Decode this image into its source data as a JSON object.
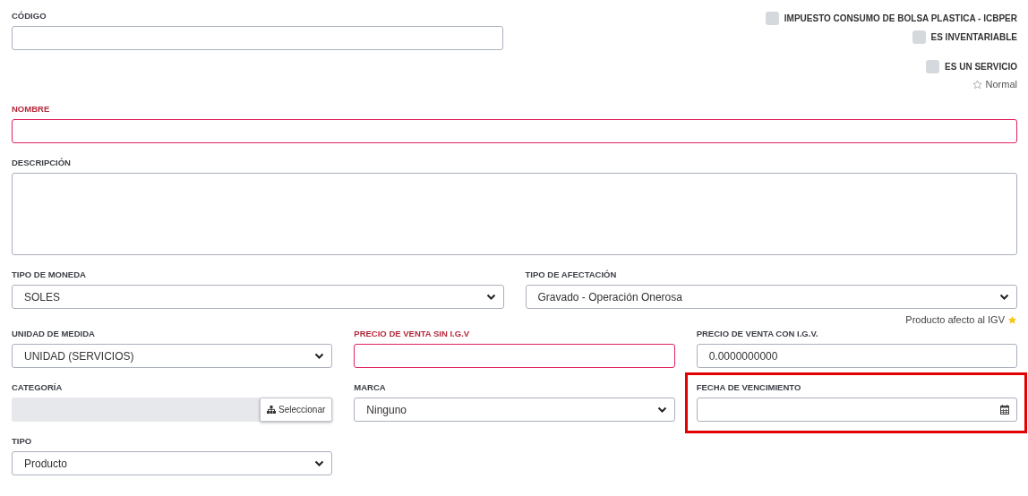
{
  "top": {
    "field": {
      "label": "CÓDIGO",
      "kind": "text",
      "required": false
    },
    "flags": [
      {
        "label": "IMPUESTO CONSUMO DE BOLSA PLASTICA - ICBPER",
        "checked": false
      },
      {
        "label": "ES INVENTARIABLE",
        "checked": false
      },
      {
        "label": "ES UN SERVICIO",
        "checked": false
      }
    ],
    "priority": {
      "label": "Normal",
      "starred": false
    }
  },
  "rows": [
    {
      "kind": "full",
      "fields": [
        {
          "label": "NOMBRE",
          "kind": "text",
          "required": true
        }
      ]
    },
    {
      "kind": "full",
      "fields": [
        {
          "label": "DESCRIPCIÓN",
          "kind": "textarea",
          "required": false
        }
      ]
    },
    {
      "kind": "halves",
      "fields": [
        {
          "label": "TIPO DE MONEDA",
          "kind": "select",
          "value": "SOLES",
          "required": false
        },
        {
          "label": "TIPO DE AFECTACIÓN",
          "kind": "select",
          "value": "Gravado - Operación Onerosa",
          "required": false,
          "note": "Producto afecto al IGV"
        }
      ]
    },
    {
      "kind": "thirds",
      "fields": [
        {
          "label": "UNIDAD DE MEDIDA",
          "kind": "select",
          "value": "UNIDAD (SERVICIOS)",
          "required": false
        },
        {
          "label": "PRECIO DE VENTA SIN I.G.V",
          "kind": "text",
          "required": true
        },
        {
          "label": "PRECIO DE VENTA CON I.G.V.",
          "kind": "text",
          "value": "0.0000000000",
          "required": false
        }
      ]
    },
    {
      "kind": "thirds",
      "fields": [
        {
          "label": "CATEGORÍA",
          "kind": "picker",
          "button": "Seleccionar",
          "required": false
        },
        {
          "label": "MARCA",
          "kind": "select",
          "value": "Ninguno",
          "required": false
        },
        {
          "label": "FECHA DE VENCIMIENTO",
          "kind": "date",
          "required": false,
          "highlighted": true
        }
      ]
    },
    {
      "kind": "thirds",
      "fields": [
        {
          "label": "TIPO",
          "kind": "select",
          "value": "Producto",
          "required": false
        }
      ]
    }
  ]
}
